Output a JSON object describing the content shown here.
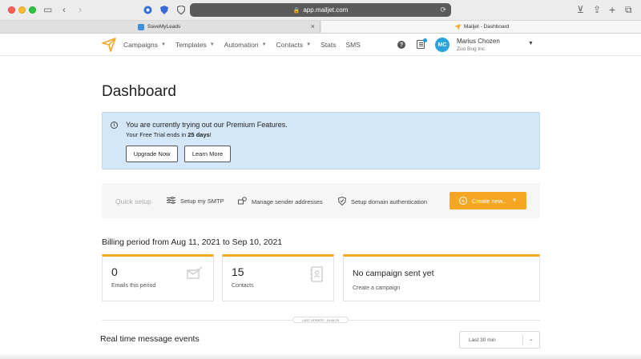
{
  "browser": {
    "url": "app.mailjet.com",
    "tabs": [
      {
        "title": "SaveMyLeads",
        "active": false
      },
      {
        "title": "Mailjet - Dashboard",
        "active": true
      }
    ]
  },
  "nav": {
    "items": [
      {
        "label": "Campaigns",
        "has_caret": true
      },
      {
        "label": "Templates",
        "has_caret": true
      },
      {
        "label": "Automation",
        "has_caret": true
      },
      {
        "label": "Contacts",
        "has_caret": true
      },
      {
        "label": "Stats",
        "has_caret": false
      },
      {
        "label": "SMS",
        "has_caret": false
      }
    ],
    "user": {
      "initials": "MC",
      "name": "Marius Chozen",
      "company": "Zoo Bug Inc"
    }
  },
  "page": {
    "title": "Dashboard"
  },
  "notice": {
    "title": "You are currently trying out our Premium Features.",
    "sub_prefix": "Your Free Trial ends in ",
    "sub_days": "25 days",
    "sub_suffix": "!",
    "upgrade_label": "Upgrade Now",
    "learn_label": "Learn More"
  },
  "quick_setup": {
    "label": "Quick setup",
    "items": [
      {
        "label": "Setup my SMTP",
        "icon": "sliders-icon"
      },
      {
        "label": "Manage sender addresses",
        "icon": "sender-icon"
      },
      {
        "label": "Setup domain authentication",
        "icon": "shield-icon"
      }
    ],
    "create_label": "Create new..."
  },
  "billing": {
    "title": "Billing period from Aug 11, 2021 to Sep 10, 2021"
  },
  "stats": [
    {
      "value": "0",
      "label": "Emails this period",
      "icon": "envelope-icon"
    },
    {
      "value": "15",
      "label": "Contacts",
      "icon": "contacts-book-icon"
    }
  ],
  "campaign": {
    "title": "No campaign sent yet",
    "link": "Create a campaign"
  },
  "last_update": "LAST UPDATE : 19:49:29",
  "realtime": {
    "title": "Real time message events",
    "range": "Last 30 min"
  },
  "colors": {
    "accent": "#f5a623",
    "notice_bg": "#d4e7f8",
    "avatar": "#29a3dd"
  }
}
